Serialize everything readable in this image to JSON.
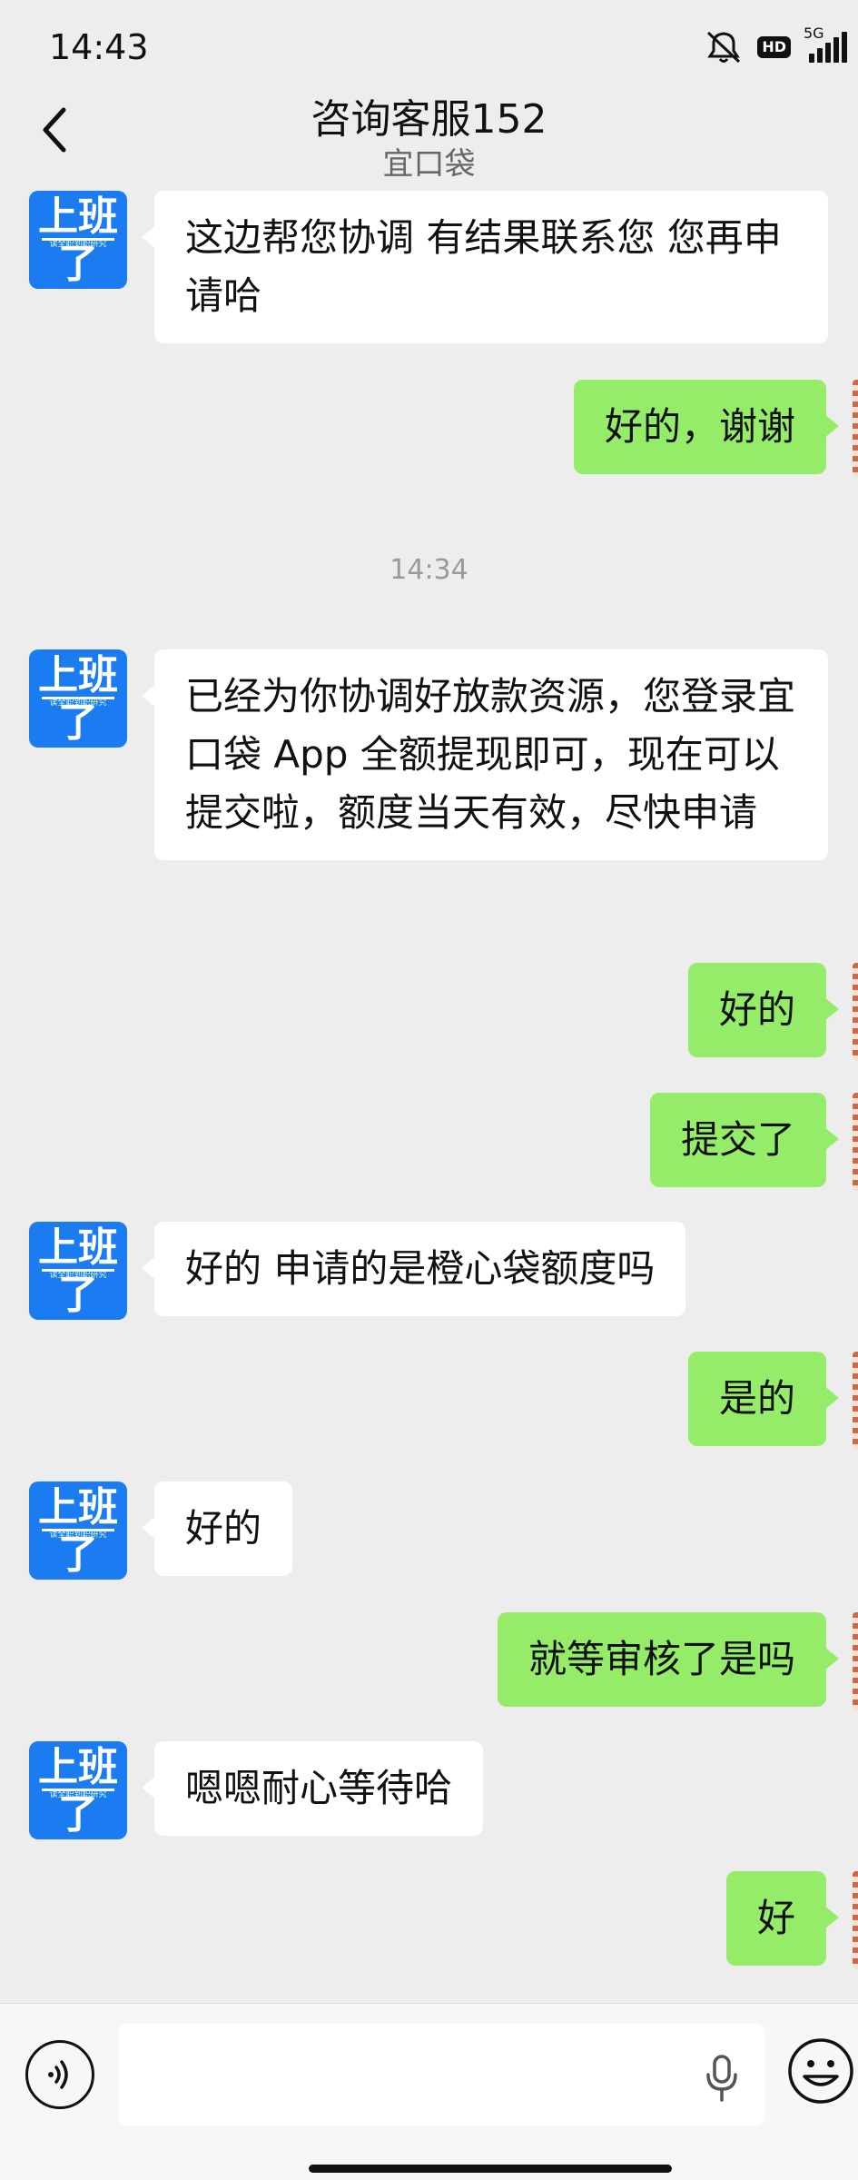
{
  "status_bar": {
    "time": "14:43",
    "network": "5G",
    "hd_badge": "HD",
    "icons": [
      "mute-icon",
      "hd-icon",
      "signal-icon"
    ]
  },
  "header": {
    "title": "咨询客服152",
    "subtitle": "宜口袋",
    "back_icon": "chevron-left-icon"
  },
  "contact_avatar": {
    "line1": "上班",
    "line2": "了",
    "small_text": "读全职到职研究",
    "color": "#1a7cf0"
  },
  "chat": {
    "messages": [
      {
        "side": "left",
        "text": "这边帮您协调 有结果联系您 您再申请哈"
      },
      {
        "side": "right",
        "text": "好的，谢谢"
      },
      {
        "side": "time",
        "text": "14:34"
      },
      {
        "side": "left",
        "text": "已经为你协调好放款资源，您登录宜口袋 App 全额提现即可，现在可以提交啦，额度当天有效，尽快申请"
      },
      {
        "side": "right",
        "text": "好的"
      },
      {
        "side": "right",
        "text": "提交了"
      },
      {
        "side": "left",
        "text": "好的 申请的是橙心袋额度吗"
      },
      {
        "side": "right",
        "text": "是的"
      },
      {
        "side": "left",
        "text": "好的"
      },
      {
        "side": "right",
        "text": "就等审核了是吗"
      },
      {
        "side": "left",
        "text": "嗯嗯耐心等待哈"
      },
      {
        "side": "right",
        "text": "好"
      }
    ]
  },
  "input_bar": {
    "placeholder": "",
    "value": "",
    "voice_icon": "voice-icon",
    "mic_icon": "mic-icon",
    "emoji_icon": "emoji-icon"
  },
  "colors": {
    "background": "#ededed",
    "bubble_self": "#95ec69",
    "bubble_other": "#ffffff",
    "timestamp": "#9a9a9a"
  }
}
